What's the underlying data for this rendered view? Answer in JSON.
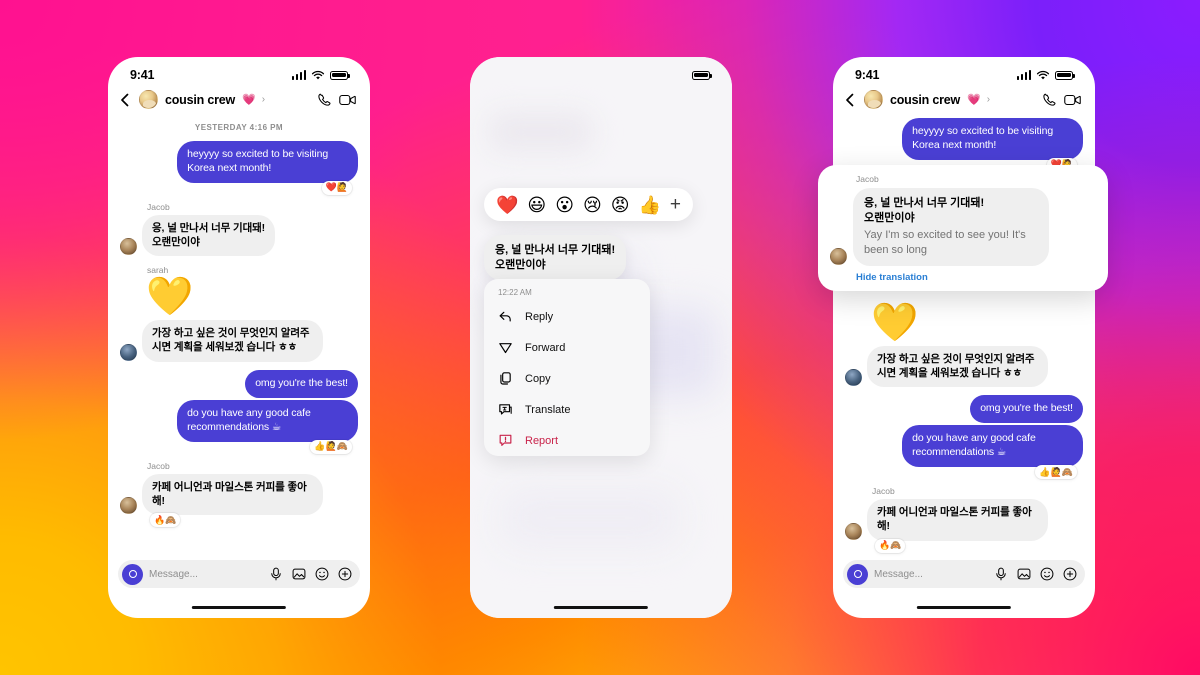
{
  "background": {
    "name": "instagram-gradient",
    "colors": [
      "#ff1f8e",
      "#7b1ffa",
      "#ff5722",
      "#ffc400",
      "#ff0a63"
    ]
  },
  "status_bar": {
    "time": "9:41",
    "signal_icon": "cellular-bars-icon",
    "wifi_icon": "wifi-icon",
    "battery_icon": "battery-full-icon"
  },
  "header": {
    "back_icon": "back-chevron-icon",
    "avatar": "group-avatar",
    "title": "cousin crew",
    "title_emoji": "💗",
    "chevron": "›",
    "call_icon": "phone-call-icon",
    "video_icon": "video-call-icon"
  },
  "composer": {
    "camera_icon": "camera-button",
    "placeholder": "Message...",
    "mic_icon": "microphone-icon",
    "photo_icon": "image-icon",
    "sticker_icon": "sticker-icon",
    "plus_icon": "plus-circle-icon"
  },
  "phone1": {
    "daystamp": "YESTERDAY 4:16 PM",
    "messages": [
      {
        "dir": "out",
        "text": "heyyyy so excited to be visiting Korea next month!",
        "reactions": "❤️🙋"
      },
      {
        "dir": "in",
        "sender": "Jacob",
        "text": "응, 널 만나서 너무 기대돼!\n오랜만이야"
      },
      {
        "dir": "in",
        "sender": "sarah",
        "sticker": "💛"
      },
      {
        "dir": "in",
        "text": "가장 하고 싶은 것이 무엇인지 알려주시면 계획을 세워보겠 습니다 ㅎㅎ"
      },
      {
        "dir": "out",
        "text": "omg you're the best!"
      },
      {
        "dir": "out",
        "text": "do you have any good cafe recommendations ☕",
        "reactions": "👍🙋🙈"
      },
      {
        "dir": "in",
        "sender": "Jacob",
        "text": "카페 어니언과 마일스톤 커피를 좋아해!",
        "reactions": "🔥🙈"
      }
    ]
  },
  "phone2": {
    "reaction_bar": {
      "emojis": [
        "❤️",
        "😃",
        "😮",
        "😢",
        "😡",
        "👍"
      ],
      "add_label": "+"
    },
    "focused_message": "응, 널 만나서 너무 기대돼!\n오랜만이야",
    "menu_time": "12:22 AM",
    "menu_items": [
      {
        "label": "Reply",
        "icon": "reply-arrow-icon",
        "danger": false
      },
      {
        "label": "Forward",
        "icon": "forward-paper-plane-icon",
        "danger": false
      },
      {
        "label": "Copy",
        "icon": "copy-icon",
        "danger": false
      },
      {
        "label": "Translate",
        "icon": "translate-icon",
        "danger": false
      },
      {
        "label": "Report",
        "icon": "report-warning-icon",
        "danger": true
      }
    ]
  },
  "phone3": {
    "messages": [
      {
        "dir": "out",
        "text": "heyyyy so excited to be visiting Korea next month!",
        "reactions": "❤️🙋"
      },
      {
        "dir": "in",
        "sticker": "💛"
      },
      {
        "dir": "in",
        "text": "가장 하고 싶은 것이 무엇인지 알려주시면 계획을 세워보겠 습니다 ㅎㅎ"
      },
      {
        "dir": "out",
        "text": "omg you're the best!"
      },
      {
        "dir": "out",
        "text": "do you have any good cafe recommendations ☕",
        "reactions": "👍🙋🙈"
      },
      {
        "dir": "in",
        "sender": "Jacob",
        "text": "카페 어니언과 마일스톤 커피를 좋아해!",
        "reactions": "🔥🙈"
      }
    ],
    "translation_card": {
      "sender": "Jacob",
      "original": "응, 널 만나서 너무 기대돼!\n오랜만이야",
      "translated": "Yay I'm so excited to see you! It's been so long",
      "hide_label": "Hide translation",
      "link_color": "#2a7fd4"
    }
  }
}
